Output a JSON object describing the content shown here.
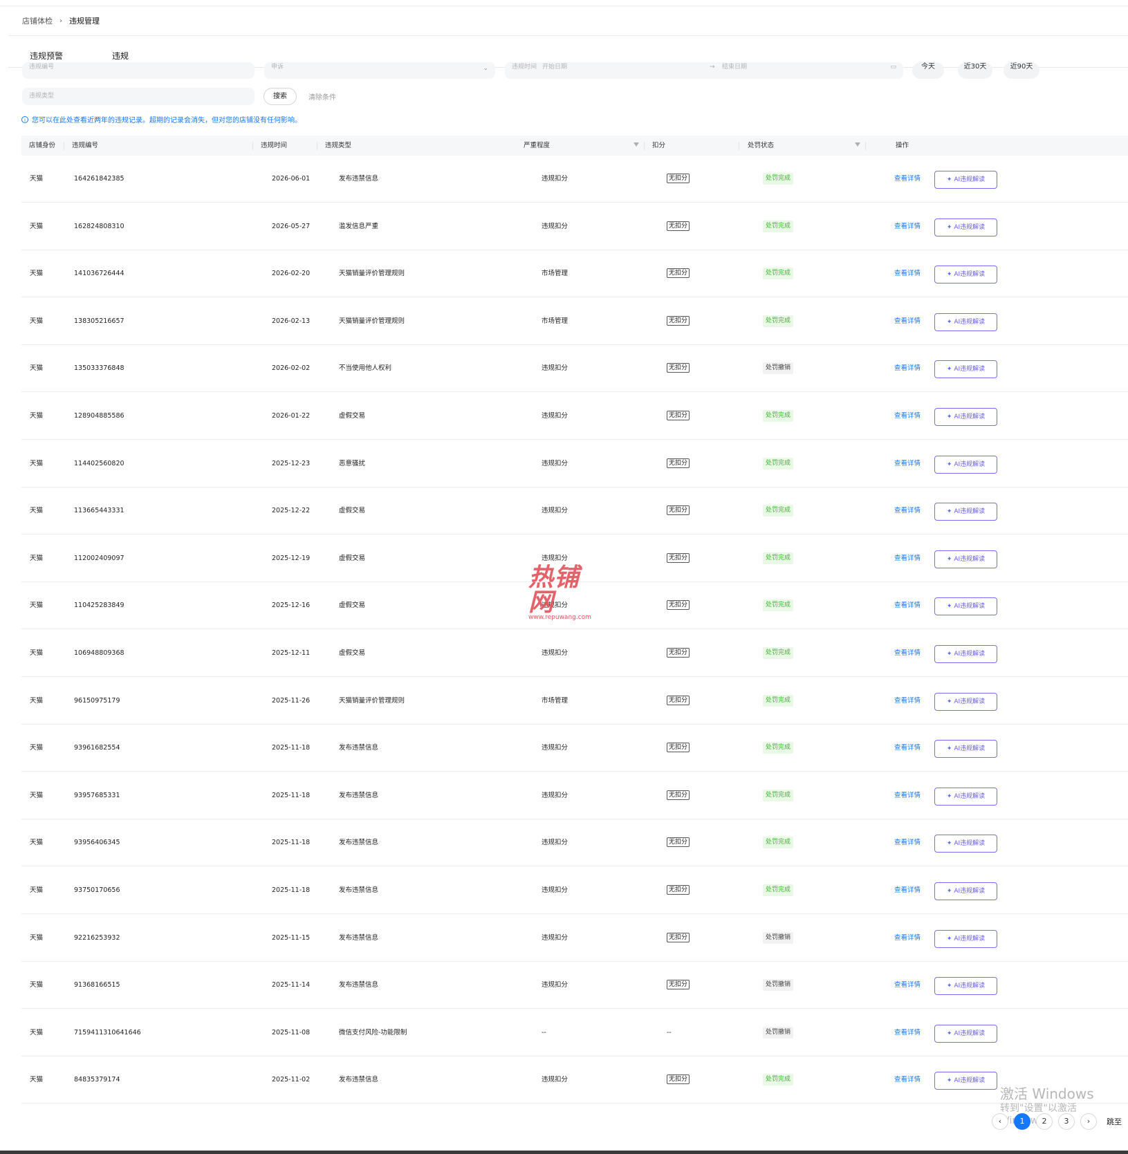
{
  "breadcrumb": {
    "parent": "店铺体检",
    "separator": "›",
    "current": "违规管理"
  },
  "tabs": [
    {
      "label": "违规预警",
      "active": false
    },
    {
      "label": "违规",
      "active": true
    }
  ],
  "filters": {
    "id_placeholder": "违规编号",
    "appeal_placeholder": "申诉",
    "date_label": "违规时间",
    "date_start": "开始日期",
    "date_arrow": "→",
    "date_end": "结束日期",
    "quick": [
      "今天",
      "近30天",
      "近90天"
    ],
    "type_placeholder": "违规类型",
    "search_label": "搜索",
    "clear_label": "清除条件"
  },
  "notice": {
    "icon": "i",
    "text": "您可以在此处查看近两年的违规记录。超期的记录会消失，但对您的店铺没有任何影响。"
  },
  "columns": [
    "店铺身份",
    "违规编号",
    "违规时间",
    "违规类型",
    "严重程度",
    "扣分",
    "处罚状态",
    "操作"
  ],
  "actions": {
    "detail": "查看详情",
    "ai_icon": "✦",
    "ai": "AI违规解读"
  },
  "rows": [
    {
      "shop": "天猫",
      "id": "164261842385",
      "date": "2026-06-01",
      "type": "发布违禁信息",
      "severity": "违规扣分",
      "score": "无扣分",
      "status": "处罚完成",
      "status_kind": "done"
    },
    {
      "shop": "天猫",
      "id": "162824808310",
      "date": "2026-05-27",
      "type": "滥发信息严重",
      "severity": "违规扣分",
      "score": "无扣分",
      "status": "处罚完成",
      "status_kind": "done"
    },
    {
      "shop": "天猫",
      "id": "141036726444",
      "date": "2026-02-20",
      "type": "天猫销量评价管理规则",
      "severity": "市场管理",
      "score": "无扣分",
      "status": "处罚完成",
      "status_kind": "done"
    },
    {
      "shop": "天猫",
      "id": "138305216657",
      "date": "2026-02-13",
      "type": "天猫销量评价管理规则",
      "severity": "市场管理",
      "score": "无扣分",
      "status": "处罚完成",
      "status_kind": "done"
    },
    {
      "shop": "天猫",
      "id": "135033376848",
      "date": "2026-02-02",
      "type": "不当使用他人权利",
      "severity": "违规扣分",
      "score": "无扣分",
      "status": "处罚撤销",
      "status_kind": "revoked"
    },
    {
      "shop": "天猫",
      "id": "128904885586",
      "date": "2026-01-22",
      "type": "虚假交易",
      "severity": "违规扣分",
      "score": "无扣分",
      "status": "处罚完成",
      "status_kind": "done"
    },
    {
      "shop": "天猫",
      "id": "114402560820",
      "date": "2025-12-23",
      "type": "恶意骚扰",
      "severity": "违规扣分",
      "score": "无扣分",
      "status": "处罚完成",
      "status_kind": "done"
    },
    {
      "shop": "天猫",
      "id": "113665443331",
      "date": "2025-12-22",
      "type": "虚假交易",
      "severity": "违规扣分",
      "score": "无扣分",
      "status": "处罚完成",
      "status_kind": "done"
    },
    {
      "shop": "天猫",
      "id": "112002409097",
      "date": "2025-12-19",
      "type": "虚假交易",
      "severity": "违规扣分",
      "score": "无扣分",
      "status": "处罚完成",
      "status_kind": "done"
    },
    {
      "shop": "天猫",
      "id": "110425283849",
      "date": "2025-12-16",
      "type": "虚假交易",
      "severity": "违规扣分",
      "score": "无扣分",
      "status": "处罚完成",
      "status_kind": "done"
    },
    {
      "shop": "天猫",
      "id": "106948809368",
      "date": "2025-12-11",
      "type": "虚假交易",
      "severity": "违规扣分",
      "score": "无扣分",
      "status": "处罚完成",
      "status_kind": "done"
    },
    {
      "shop": "天猫",
      "id": "96150975179",
      "date": "2025-11-26",
      "type": "天猫销量评价管理规则",
      "severity": "市场管理",
      "score": "无扣分",
      "status": "处罚完成",
      "status_kind": "done"
    },
    {
      "shop": "天猫",
      "id": "93961682554",
      "date": "2025-11-18",
      "type": "发布违禁信息",
      "severity": "违规扣分",
      "score": "无扣分",
      "status": "处罚完成",
      "status_kind": "done"
    },
    {
      "shop": "天猫",
      "id": "93957685331",
      "date": "2025-11-18",
      "type": "发布违禁信息",
      "severity": "违规扣分",
      "score": "无扣分",
      "status": "处罚完成",
      "status_kind": "done"
    },
    {
      "shop": "天猫",
      "id": "93956406345",
      "date": "2025-11-18",
      "type": "发布违禁信息",
      "severity": "违规扣分",
      "score": "无扣分",
      "status": "处罚完成",
      "status_kind": "done"
    },
    {
      "shop": "天猫",
      "id": "93750170656",
      "date": "2025-11-18",
      "type": "发布违禁信息",
      "severity": "违规扣分",
      "score": "无扣分",
      "status": "处罚完成",
      "status_kind": "done"
    },
    {
      "shop": "天猫",
      "id": "92216253932",
      "date": "2025-11-15",
      "type": "发布违禁信息",
      "severity": "违规扣分",
      "score": "无扣分",
      "status": "处罚撤销",
      "status_kind": "revoked"
    },
    {
      "shop": "天猫",
      "id": "91368166515",
      "date": "2025-11-14",
      "type": "发布违禁信息",
      "severity": "违规扣分",
      "score": "无扣分",
      "status": "处罚撤销",
      "status_kind": "revoked"
    },
    {
      "shop": "天猫",
      "id": "7159411310641646",
      "date": "2025-11-08",
      "type": "微信支付风险-功能限制",
      "severity": "--",
      "score": "--",
      "status": "处罚撤销",
      "status_kind": "revoked"
    },
    {
      "shop": "天猫",
      "id": "84835379174",
      "date": "2025-11-02",
      "type": "发布违禁信息",
      "severity": "违规扣分",
      "score": "无扣分",
      "status": "处罚完成",
      "status_kind": "done"
    }
  ],
  "watermark": {
    "main": "热铺网",
    "sub": "www.repuwang.com"
  },
  "windows_notice": {
    "line1": "激活 Windows",
    "line2": "转到\"设置\"以激活 Windows。"
  },
  "pagination": {
    "prev": "‹",
    "pages": [
      "1",
      "2",
      "3"
    ],
    "current": "1",
    "next": "›",
    "jump_label": "跳至"
  }
}
